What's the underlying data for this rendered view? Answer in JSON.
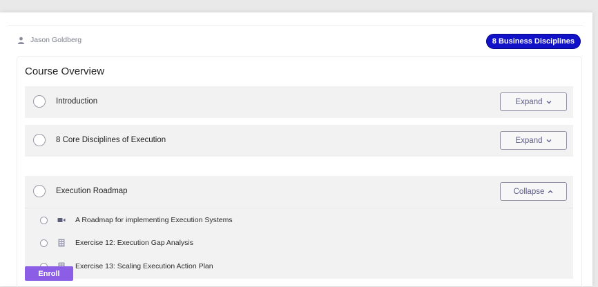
{
  "author": {
    "name": "Jason Goldberg",
    "icon": "user-icon"
  },
  "badge": "8 Business Disciplines",
  "overview_title": "Course Overview",
  "sections": [
    {
      "title": "Introduction",
      "button": "Expand",
      "chevron": "⌄"
    },
    {
      "title": "8 Core Disciplines of Execution",
      "button": "Expand",
      "chevron": "⌄"
    },
    {
      "title": "Execution Roadmap",
      "button": "Collapse",
      "chevron": "^"
    }
  ],
  "lessons": [
    {
      "title": "A Roadmap for implementing Execution Systems",
      "icon": "video-icon"
    },
    {
      "title": "Exercise 12: Execution Gap Analysis",
      "icon": "worksheet-icon"
    },
    {
      "title": "Exercise 13: Scaling Execution Action Plan",
      "icon": "worksheet-icon"
    }
  ],
  "enroll_label": "Enroll",
  "colors": {
    "badge": "#1111c8",
    "enroll": "#8c5ee6",
    "section_bg": "#f2f2f3"
  }
}
